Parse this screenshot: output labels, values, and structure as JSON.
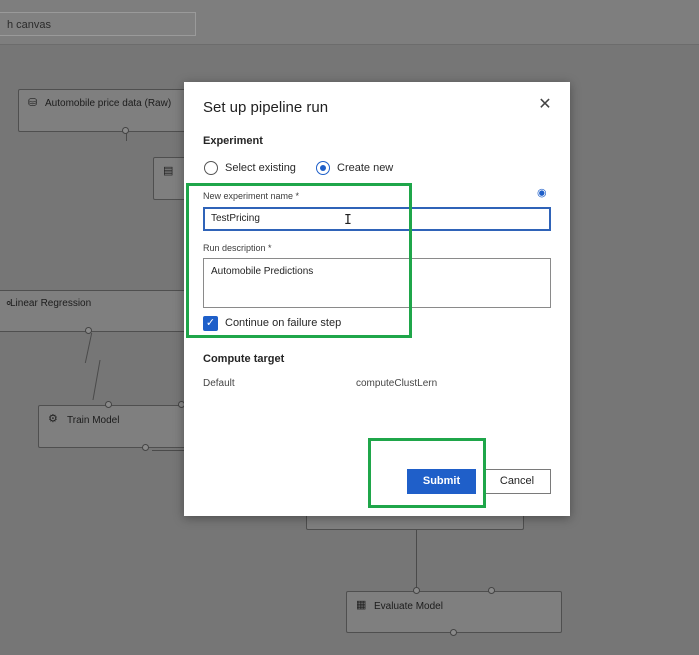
{
  "canvas": {
    "search_text": "h canvas",
    "nodes": [
      {
        "icon": "database-icon",
        "glyph": "⛁",
        "label": "Automobile price data (Raw)"
      },
      {
        "icon": "module-icon",
        "glyph": "▤",
        "label": ""
      },
      {
        "icon": "regression-icon",
        "glyph": "⚬",
        "label": "Linear Regression"
      },
      {
        "icon": "train-icon",
        "glyph": "⚙",
        "label": "Train Model"
      },
      {
        "icon": "evaluate-icon",
        "glyph": "▦",
        "label": "Evaluate Model"
      }
    ]
  },
  "dialog": {
    "title": "Set up pipeline run",
    "close_glyph": "✕",
    "experiment_heading": "Experiment",
    "radio_select_existing": "Select existing",
    "radio_create_new": "Create new",
    "new_experiment_label": "New experiment name *",
    "new_experiment_value": "TestPricing",
    "run_description_label": "Run description *",
    "run_description_value": "Automobile Predictions",
    "continue_on_failure_label": "Continue on failure step",
    "compute_heading": "Compute target",
    "compute_default_label": "Default",
    "compute_value": "computeClustLern",
    "submit_label": "Submit",
    "cancel_label": "Cancel"
  },
  "colors": {
    "accent": "#1e5fc9",
    "highlight": "#1fa64a"
  }
}
